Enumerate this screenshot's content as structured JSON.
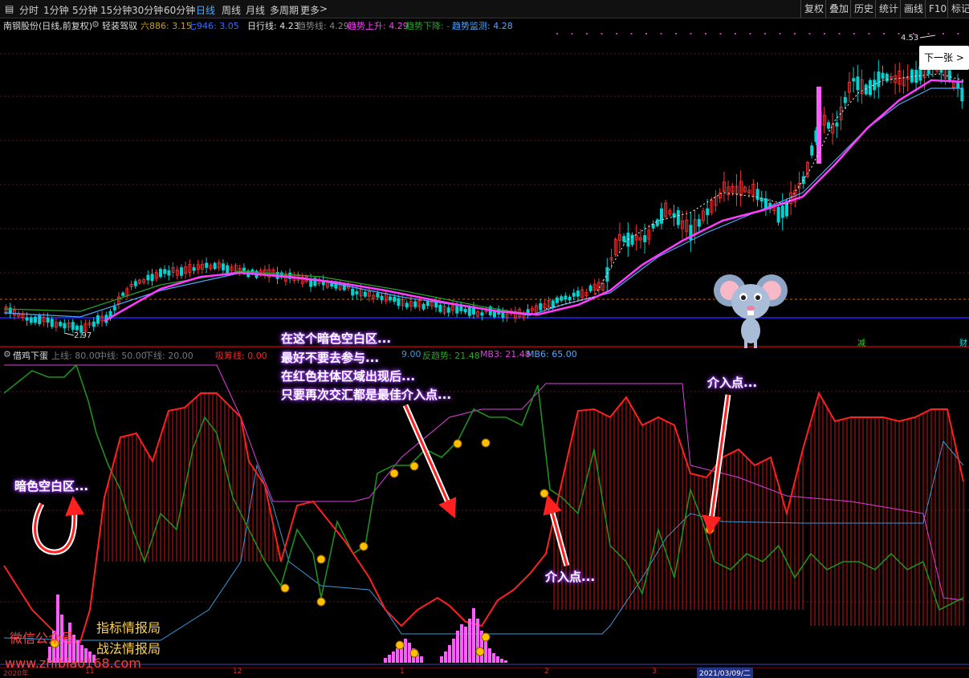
{
  "toolbar": {
    "periods": [
      "分时",
      "1分钟",
      "5分钟",
      "15分钟",
      "30分钟",
      "60分钟",
      "日线",
      "周线",
      "月线",
      "多周期",
      "更多"
    ],
    "active_period": "日线",
    "right_buttons": [
      "复权",
      "叠加",
      "历史",
      "统计",
      "画线",
      "F10",
      "标记"
    ]
  },
  "stock": {
    "name": "南钢股份(日线,前复权)",
    "indicator_name": "轻装驾驭",
    "ma6_label": "六886: 3.15",
    "ma7_label": "七946: 3.05",
    "day_line": "日行线: 4.23",
    "trend_line": "趋势线: 4.29",
    "trend_up": "趋势上升: 4.29",
    "trend_down": "趋势下降: -",
    "trend_monitor": "趋势监测: 4.28",
    "high_label": "4.53",
    "low_label": "2.97",
    "tag_jian": "减",
    "tag_cai": "财"
  },
  "indicator": {
    "name": "借鸡下蛋",
    "upper": "上线: 80.00",
    "middle": "中线: 50.00",
    "lower": "下线: 20.00",
    "accum": "吸筹线: 0.00",
    "reverse": "反趋势: 21.48",
    "mb3": "MB3: 21.48",
    "mb6": "MB6: 65.00",
    "mid_val": "9.00"
  },
  "annotations": {
    "dark_zone": "暗色空白区...",
    "note1": "在这个暗色空白区...",
    "note2": "最好不要去参与...",
    "note3": "在红色柱体区域出现后...",
    "note4": "只要再次交汇都是最佳介入点...",
    "entry1": "介入点...",
    "entry2": "介入点..."
  },
  "watermark": {
    "wechat": "微信公众号",
    "line1": "指标情报局",
    "line2": "战法情报局",
    "url": "www.zhibiao168.com"
  },
  "next_button": "下一张",
  "axis_labels": [
    "2020年",
    "11",
    "12",
    "1",
    "2",
    "3",
    "2021/03/09/二"
  ],
  "colors": {
    "up": "#ff3232",
    "down": "#00d2d2",
    "magenta": "#ff3cff",
    "trend": "#4ea7ff",
    "green": "#2aa32a"
  }
}
